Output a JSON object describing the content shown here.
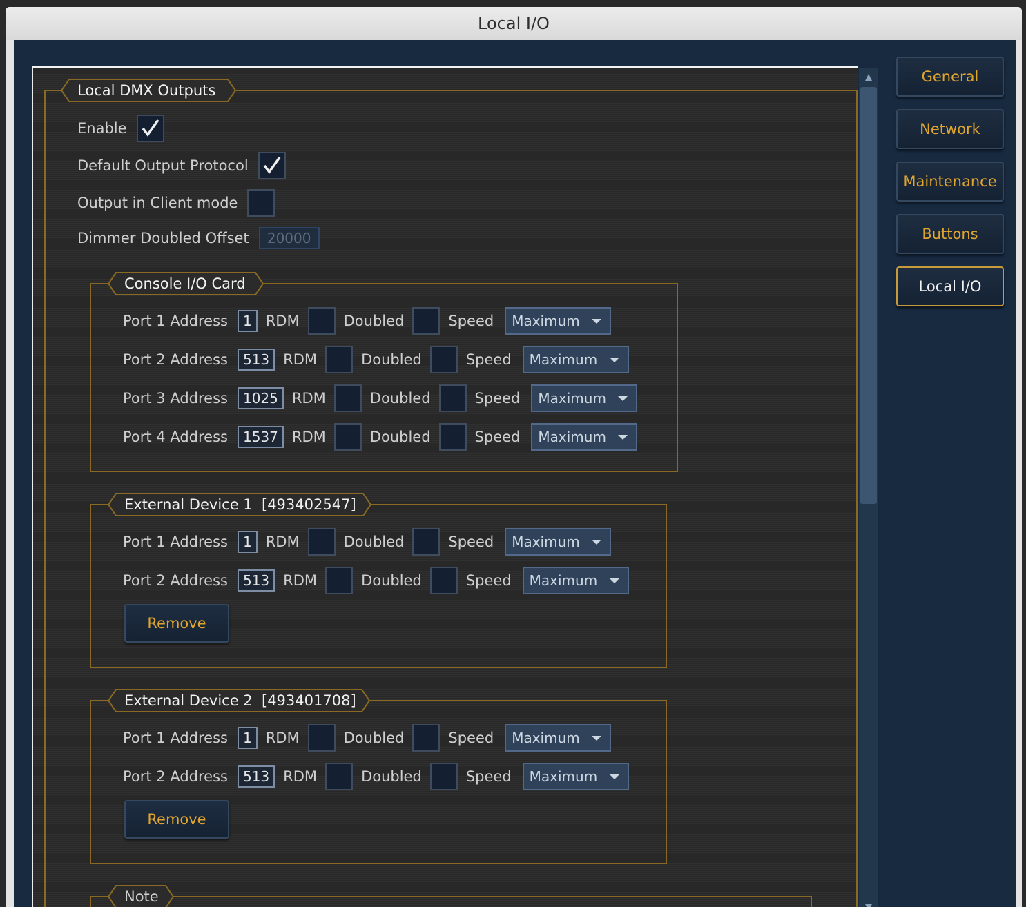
{
  "window": {
    "title": "Local I/O"
  },
  "nav": {
    "items": [
      {
        "label": "General",
        "active": false
      },
      {
        "label": "Network",
        "active": false
      },
      {
        "label": "Maintenance",
        "active": false
      },
      {
        "label": "Buttons",
        "active": false
      },
      {
        "label": "Local I/O",
        "active": true
      }
    ]
  },
  "dmx": {
    "title": "Local DMX Outputs",
    "enable": {
      "label": "Enable",
      "checked": true
    },
    "default_protocol": {
      "label": "Default Output Protocol",
      "checked": true
    },
    "client_mode": {
      "label": "Output in Client mode",
      "checked": false
    },
    "dimmer_offset": {
      "label": "Dimmer Doubled Offset",
      "value": "20000"
    }
  },
  "labels": {
    "rdm": "RDM",
    "doubled": "Doubled",
    "speed": "Speed",
    "remove": "Remove"
  },
  "console_card": {
    "title": "Console I/O Card",
    "ports": [
      {
        "label": "Port 1 Address",
        "address": "1",
        "speed": "Maximum"
      },
      {
        "label": "Port 2 Address",
        "address": "513",
        "speed": "Maximum"
      },
      {
        "label": "Port 3 Address",
        "address": "1025",
        "speed": "Maximum"
      },
      {
        "label": "Port 4 Address",
        "address": "1537",
        "speed": "Maximum"
      }
    ]
  },
  "ext1": {
    "title": "External Device 1  [493402547]",
    "ports": [
      {
        "label": "Port 1 Address",
        "address": "1",
        "speed": "Maximum"
      },
      {
        "label": "Port 2 Address",
        "address": "513",
        "speed": "Maximum"
      }
    ]
  },
  "ext2": {
    "title": "External Device 2  [493401708]",
    "ports": [
      {
        "label": "Port 1 Address",
        "address": "1",
        "speed": "Maximum"
      },
      {
        "label": "Port 2 Address",
        "address": "513",
        "speed": "Maximum"
      }
    ]
  },
  "note": {
    "title": "Note"
  },
  "colors": {
    "accent": "#e0a52e",
    "frame": "#8a6a22",
    "background": "#172a40"
  },
  "icons": {
    "check": "checkmark-icon",
    "dropdown": "chevron-down-icon"
  }
}
